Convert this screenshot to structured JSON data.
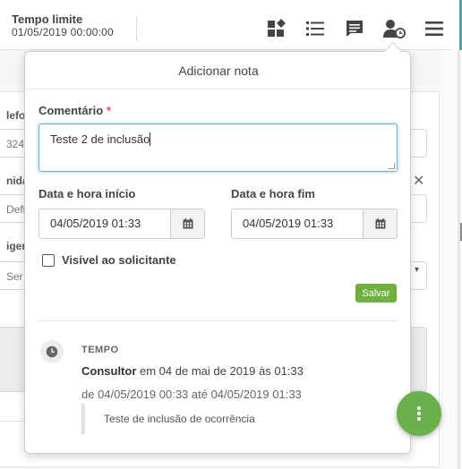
{
  "header": {
    "deadline_label": "Tempo limite",
    "deadline_value": "01/05/2019 00:00:00",
    "icons": [
      "dashboard-icon",
      "list-icon",
      "comment-icon",
      "user-clock-icon",
      "menu-icon"
    ]
  },
  "background_form": {
    "label_1": "lefo",
    "value_1": "324",
    "label_2": "nida",
    "value_2": "Defi",
    "label_3": "igen",
    "value_3": "Ser",
    "close_glyph": "✕",
    "caret_glyph": "▾"
  },
  "popover": {
    "title": "Adicionar nota",
    "comment_label": "Comentário",
    "required_mark": "*",
    "comment_value": "Teste 2 de inclusão",
    "start_label": "Data e hora início",
    "start_value": "04/05/2019 01:33",
    "end_label": "Data e hora fim",
    "end_value": "04/05/2019 01:33",
    "visible_label": "Visível ao solicitante",
    "visible_checked": false,
    "save_label": "Salvar"
  },
  "timeline": {
    "type": "TEMPO",
    "author": "Consultor",
    "when": "em 04 de mai de 2019 às 01:33",
    "range": "de 04/05/2019 00:33 até 04/05/2019 01:33",
    "note": "Teste de inclusão de ocorrência"
  },
  "colors": {
    "accent_blue": "#66afe9",
    "save_green": "#6fb13f",
    "fab_green": "#6ab04c",
    "teal": "#4aa8a0"
  }
}
